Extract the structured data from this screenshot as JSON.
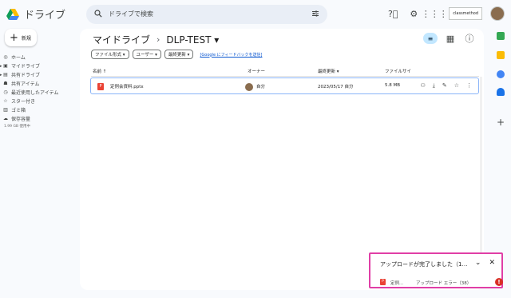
{
  "app": {
    "name": "ドライブ"
  },
  "search": {
    "placeholder": "ドライブで検索"
  },
  "topbar": {
    "badge": "classmethod"
  },
  "sidebar": {
    "new_label": "新規",
    "items": [
      {
        "label": "ホーム",
        "icon": "check-circle-icon"
      },
      {
        "label": "マイドライブ",
        "icon": "drive-icon"
      },
      {
        "label": "共有ドライブ",
        "icon": "shared-drive-icon"
      },
      {
        "label": "共有アイテム",
        "icon": "people-icon"
      },
      {
        "label": "最近使用したアイテム",
        "icon": "clock-icon"
      },
      {
        "label": "スター付き",
        "icon": "star-icon"
      },
      {
        "label": "ゴミ箱",
        "icon": "trash-icon"
      },
      {
        "label": "保存容量",
        "icon": "cloud-icon"
      }
    ],
    "storage_text": "1.99 GB 使用中"
  },
  "breadcrumb": {
    "root": "マイドライブ",
    "sep": "›",
    "current": "DLP-TEST ▾"
  },
  "filters": {
    "chips": [
      "ファイル形式 ▾",
      "ユーザー ▾",
      "最終更新 ▾"
    ],
    "feedback": "[Google にフィードバックを送信]"
  },
  "table": {
    "headers": {
      "name": "名前 ↑",
      "owner": "オーナー",
      "modified": "最終更新 ▾",
      "size": "ファイルサイ"
    },
    "rows": [
      {
        "name": "定例会資料.pptx",
        "owner": "自分",
        "modified": "2023/05/17 自分",
        "size": "5.8 MB"
      }
    ]
  },
  "toast": {
    "title": "アップロードが完了しました（1…",
    "file": "定例...",
    "status": "アップロード エラー（38）"
  },
  "colors": {
    "accent": "#0b57d0",
    "error": "#d93025",
    "highlight": "#e03ea6",
    "selected": "#c2e7ff"
  }
}
